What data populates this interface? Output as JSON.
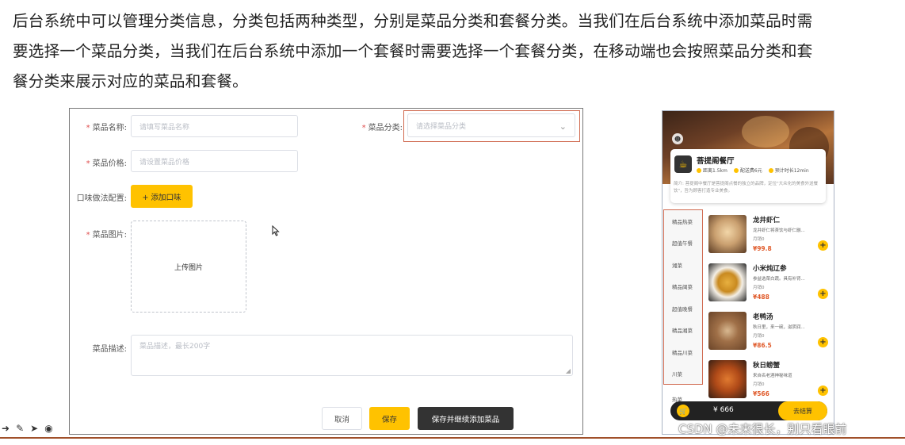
{
  "intro": {
    "line1": "后台系统中可以管理分类信息，分类包括两种类型，分别是菜品分类和套餐分类。当我们在后台系统中添加菜品时需",
    "line2": "要选择一个菜品分类，当我们在后台系统中添加一个套餐时需要选择一个套餐分类，在移动端也会按照菜品分类和套",
    "line3": "餐分类来展示对应的菜品和套餐。"
  },
  "form": {
    "name_label": "菜品名称:",
    "name_placeholder": "请填写菜品名称",
    "category_label": "菜品分类:",
    "category_placeholder": "请选择菜品分类",
    "price_label": "菜品价格:",
    "price_placeholder": "请设置菜品价格",
    "flavor_label": "口味做法配置:",
    "add_flavor_button": "+ 添加口味",
    "image_label": "菜品图片:",
    "upload_text": "上传图片",
    "desc_label": "菜品描述:",
    "desc_placeholder": "菜品描述，最长200字",
    "cancel_button": "取消",
    "save_button": "保存",
    "save_continue_button": "保存并继续添加菜品",
    "required_mark": "*"
  },
  "phone": {
    "shop_name": "菩提阁餐厅",
    "distance": "距离1.5km",
    "delivery_fee": "配送费6元",
    "eta": "预计时长12min",
    "intro": "简介: 菩提阁中餐厅是菩提阁点餐的独立的品牌，定位\"大众化的美食外送餐饮\"，旨为顾客打造专业美食。",
    "categories": [
      "精品热菜",
      "超值午餐",
      "湘菜",
      "精品闽菜",
      "超值晚餐",
      "精品湘菜",
      "精品川菜",
      "川菜"
    ],
    "extra_category": "热菜",
    "dishes": [
      {
        "name": "龙井虾仁",
        "desc": "龙井虾仁将茶饮与虾仁融...",
        "sold": "月销0",
        "price": "¥99.8"
      },
      {
        "name": "小米炖辽参",
        "desc": "参益选菜白蔬。具有补肾...",
        "sold": "月销0",
        "price": "¥488"
      },
      {
        "name": "老鸭汤",
        "desc": "秋日里，来一碗，滋阴润...",
        "sold": "月销0",
        "price": "¥86.5"
      },
      {
        "name": "秋日螃蟹",
        "desc": "来自名老酒神秘味道",
        "sold": "月销0",
        "price": "¥566"
      }
    ],
    "cart_total": "¥ 666",
    "cart_button": "去结算",
    "add_symbol": "+"
  },
  "watermark": "CSDN @未来很长，别只看眼前",
  "colors": {
    "accent": "#ffc200",
    "highlight_border": "#d06a50",
    "dark_button": "#333333"
  }
}
